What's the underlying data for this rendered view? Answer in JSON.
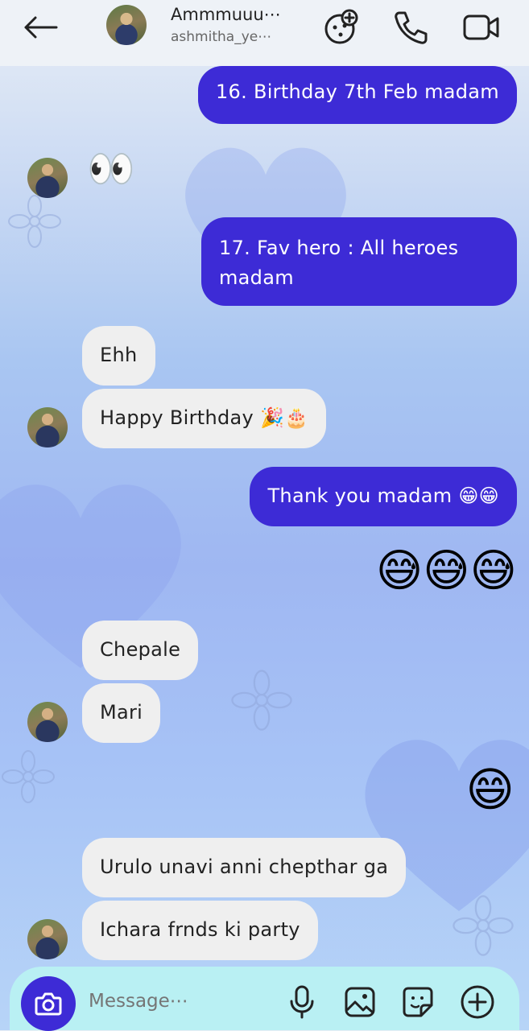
{
  "header": {
    "name": "Ammmuuu⋯",
    "username": "ashmitha_ye⋯"
  },
  "messages": [
    {
      "from": "me",
      "text": "16. Birthday 7th Feb madam"
    },
    {
      "from": "them",
      "text": "👀"
    },
    {
      "from": "me",
      "text": "17. Fav hero : All heroes",
      "text2": "madam"
    },
    {
      "from": "them",
      "text": "Ehh"
    },
    {
      "from": "them",
      "text": "Happy Birthday 🎉🎂"
    },
    {
      "from": "me",
      "text": "Thank you madam 😁😁"
    },
    {
      "from": "me",
      "text": "😅😅😅"
    },
    {
      "from": "them",
      "text": "Chepale"
    },
    {
      "from": "them",
      "text": "Mari"
    },
    {
      "from": "me",
      "text": "😄"
    },
    {
      "from": "them",
      "text": "Urulo unavi anni chepthar ga"
    },
    {
      "from": "them",
      "text": "Ichara frnds ki party"
    }
  ],
  "composer": {
    "placeholder": "Message⋯"
  },
  "colors": {
    "outgoing_bubble": "#3d2bd6",
    "incoming_bubble": "#efefef",
    "composer_bg": "#b9f0f3"
  }
}
